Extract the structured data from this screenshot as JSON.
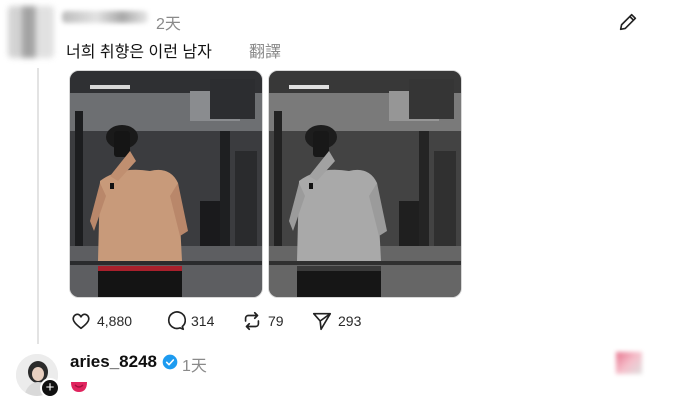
{
  "post": {
    "time": "2天",
    "text": "너희 취향은 이런 남자",
    "translate_label": "翻譯"
  },
  "actions": {
    "likes": "4,880",
    "comments": "314",
    "reposts": "79",
    "shares": "293"
  },
  "reply": {
    "username": "aries_8248",
    "time": "1天",
    "follow_symbol": "+"
  },
  "icons": [
    "edit-icon",
    "heart-icon",
    "comment-icon",
    "repost-icon",
    "share-icon",
    "verified-icon"
  ],
  "colors": {
    "verified": "#1d9bf0",
    "muted_text": "#8a8a8a"
  }
}
